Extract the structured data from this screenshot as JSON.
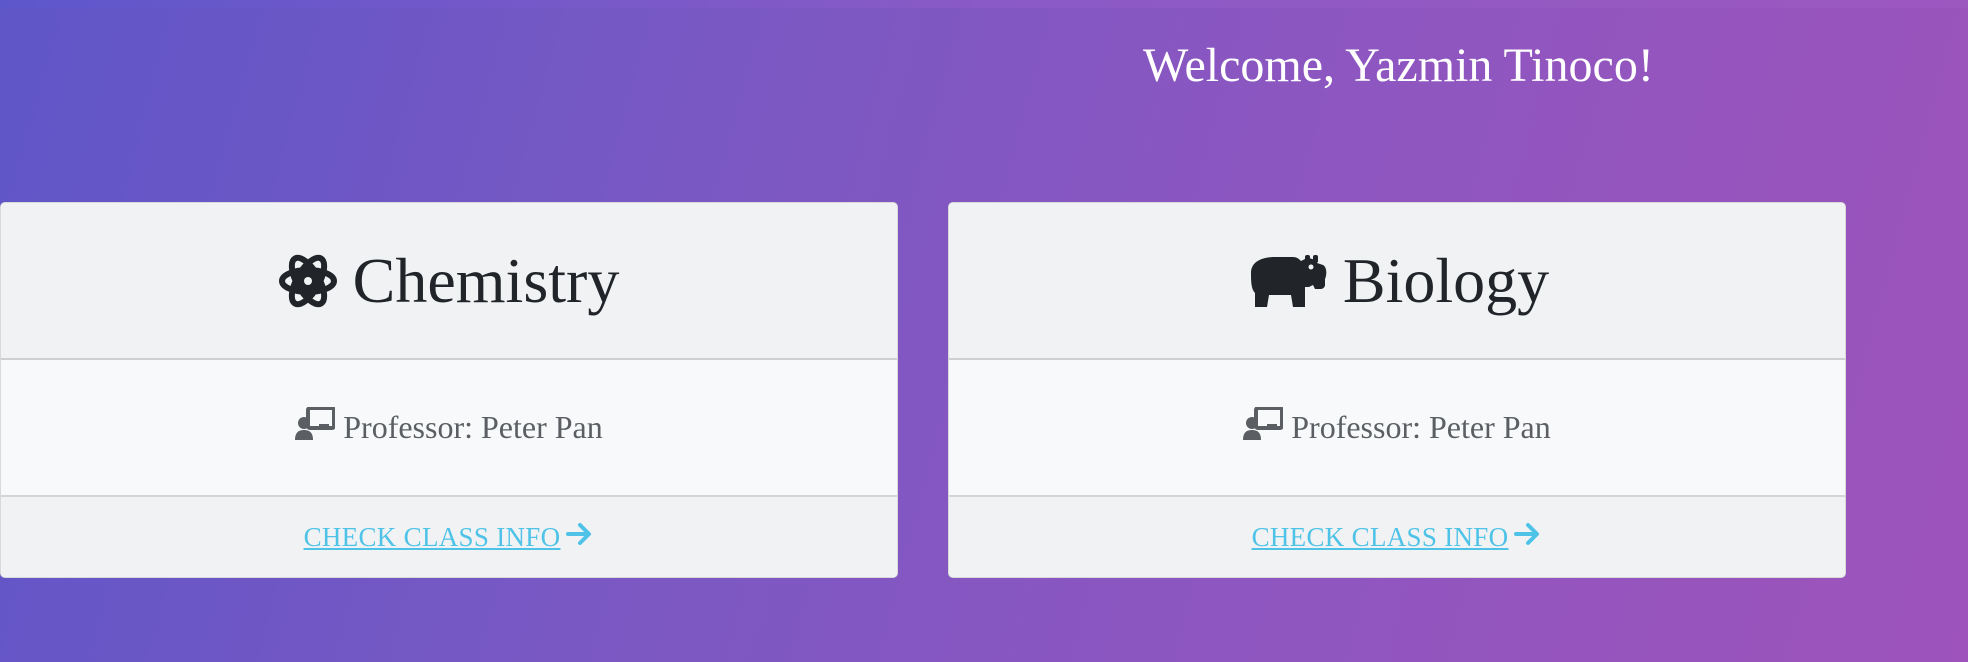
{
  "header": {
    "welcome_text": "Welcome, Yazmin Tinoco!"
  },
  "courses": [
    {
      "title": "Chemistry",
      "icon": "atom-icon",
      "professor": "Professor: Peter Pan",
      "link_label": "CHECK CLASS INFO"
    },
    {
      "title": "Biology",
      "icon": "hippo-icon",
      "professor": "Professor: Peter Pan",
      "link_label": "CHECK CLASS INFO"
    }
  ],
  "colors": {
    "link": "#4fc3e7",
    "title_text": "#212529",
    "muted_text": "#5b5f63"
  }
}
